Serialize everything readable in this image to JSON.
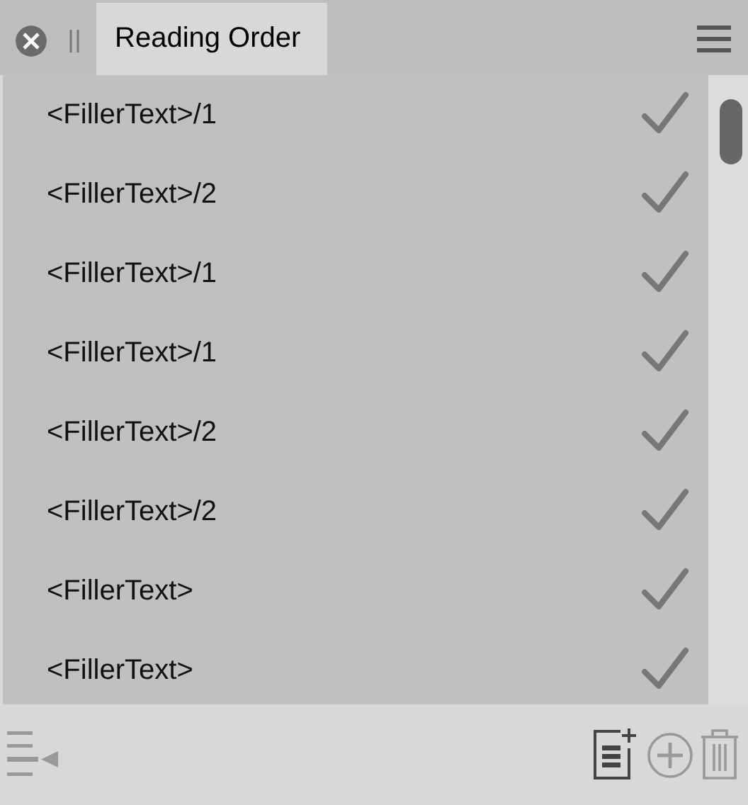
{
  "panel": {
    "tab": {
      "label": "Reading Order",
      "selected": true
    }
  },
  "items": [
    {
      "label": "<FillerText>/1",
      "checked": true
    },
    {
      "label": "<FillerText>/2",
      "checked": true
    },
    {
      "label": "<FillerText>/1",
      "checked": true
    },
    {
      "label": "<FillerText>/1",
      "checked": true
    },
    {
      "label": "<FillerText>/2",
      "checked": true
    },
    {
      "label": "<FillerText>/2",
      "checked": true
    },
    {
      "label": "<FillerText>",
      "checked": true
    },
    {
      "label": "<FillerText>",
      "checked": true
    }
  ],
  "toolbar": [
    {
      "kind": "outdent",
      "disabled": true
    },
    {
      "kind": "new-page",
      "disabled": false
    },
    {
      "kind": "add",
      "disabled": true
    },
    {
      "kind": "delete",
      "disabled": true
    }
  ]
}
